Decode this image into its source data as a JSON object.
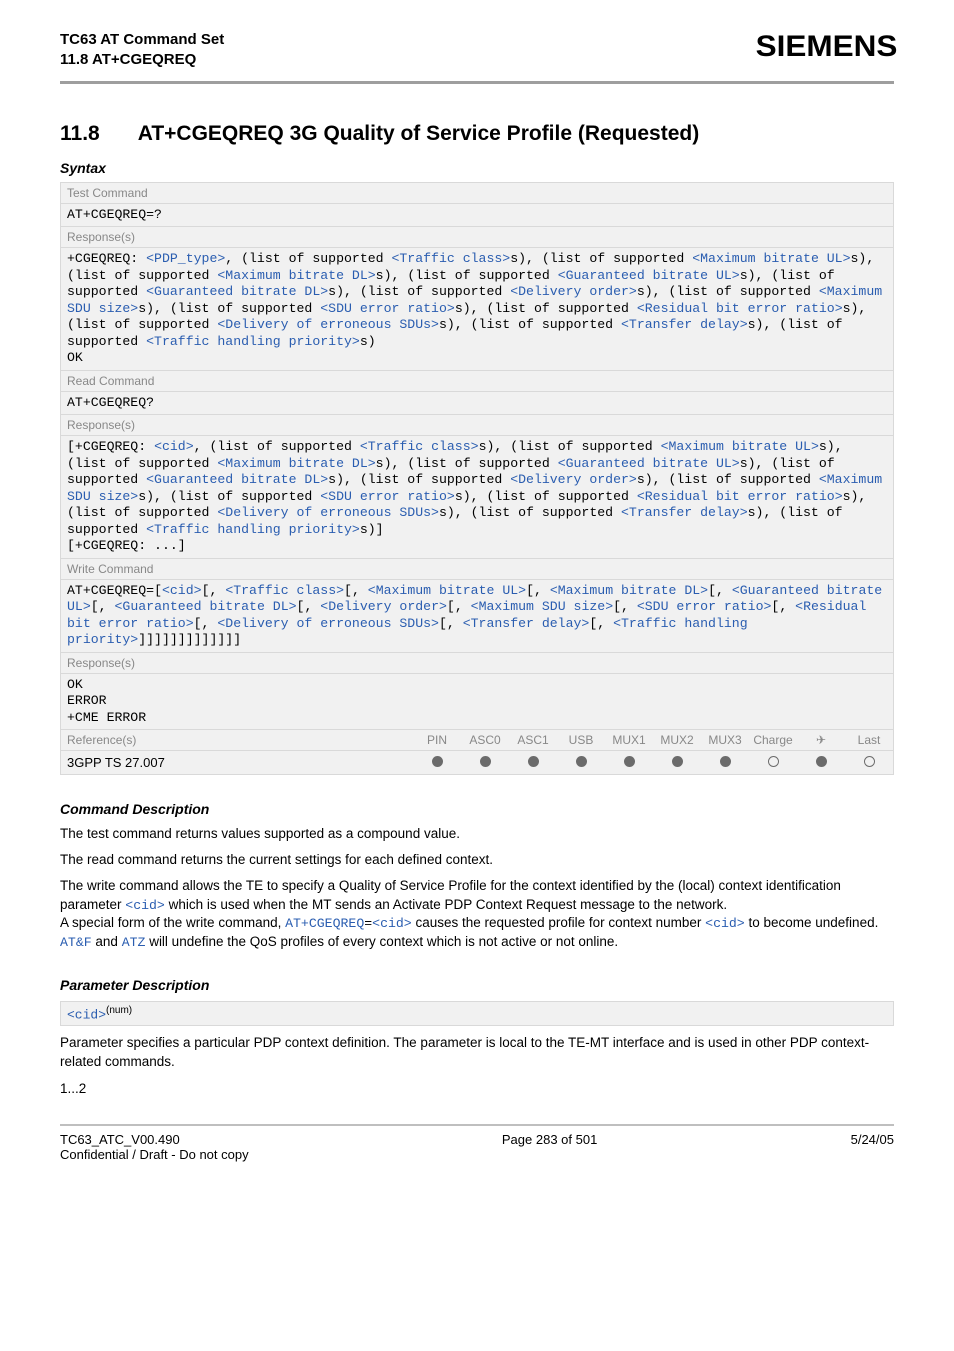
{
  "header": {
    "title_line1": "TC63 AT Command Set",
    "title_line2": "11.8 AT+CGEQREQ",
    "brand": "SIEMENS"
  },
  "section": {
    "number": "11.8",
    "title": "AT+CGEQREQ   3G Quality of Service Profile (Requested)"
  },
  "syntax_label": "Syntax",
  "labels": {
    "test_cmd": "Test Command",
    "read_cmd": "Read Command",
    "write_cmd": "Write Command",
    "responses": "Response(s)",
    "references": "Reference(s)"
  },
  "test": {
    "cmd": "AT+CGEQREQ=?",
    "resp_prefix": "+CGEQREQ: ",
    "params": {
      "pdp_type": "<PDP_type>",
      "traffic_class": "<Traffic class>",
      "max_br_ul": "<Maximum bitrate UL>",
      "max_br_dl": "<Maximum bitrate DL>",
      "gtd_br_ul": "<Guaranteed bitrate UL>",
      "gtd_br_dl": "<Guaranteed bitrate DL>",
      "del_order": "<Delivery order>",
      "max_sdu": "<Maximum SDU size>",
      "sdu_err": "<SDU error ratio>",
      "res_bit_err": "<Residual bit error ratio>",
      "del_err_sdu": "<Delivery of erroneous SDUs>",
      "transfer_delay": "<Transfer delay>",
      "traffic_prio": "<Traffic handling priority>"
    },
    "ok": "OK"
  },
  "read": {
    "cmd": "AT+CGEQREQ?",
    "resp_open": "[+CGEQREQ: ",
    "cid": "<cid>",
    "resp_trail": "[+CGEQREQ: ...]"
  },
  "write": {
    "cmd_prefix": "AT+CGEQREQ=",
    "resp_ok": "OK",
    "resp_err": "ERROR",
    "resp_cme": "+CME ERROR"
  },
  "ref_table": {
    "cols": [
      "PIN",
      "ASC0",
      "ASC1",
      "USB",
      "MUX1",
      "MUX2",
      "MUX3",
      "Charge",
      "✈",
      "Last"
    ],
    "ref_value": "3GPP TS 27.007",
    "dots": [
      "f",
      "f",
      "f",
      "f",
      "f",
      "f",
      "f",
      "o",
      "f",
      "o"
    ]
  },
  "cmd_desc_h": "Command Description",
  "cmd_desc": {
    "p1": "The test command returns values supported as a compound value.",
    "p2": "The read command returns the current settings for each defined context.",
    "p3a": "The write command allows the TE to specify a Quality of Service Profile for the context identified by the (local) context identification parameter ",
    "p3_cid": "<cid>",
    "p3b": " which is used when the MT sends an Activate PDP Context Request message to the network.",
    "p4a": "A special form of the write command, ",
    "p4_cmd": "AT+CGEQREQ",
    "p4_eq": "=",
    "p4_cid": "<cid>",
    "p4b": " causes the requested profile for context number ",
    "p4_cid2": "<cid>",
    "p4c": " to become undefined.",
    "p5a": "AT&F",
    "p5b": " and ",
    "p5c": "ATZ",
    "p5d": " will undefine the QoS profiles of every context which is not active or not online."
  },
  "param_desc_h": "Parameter Description",
  "param_cid": {
    "name": "<cid>",
    "sup": "(num)",
    "text": "Parameter specifies a particular PDP context definition. The parameter is local to the TE-MT interface and is used in other PDP context-related commands.",
    "range": "1...2"
  },
  "footer": {
    "left1": "TC63_ATC_V00.490",
    "left2": "Confidential / Draft - Do not copy",
    "center": "Page 283 of 501",
    "right": "5/24/05"
  },
  "glue": {
    "comma_list_sup": ", (list of supported ",
    "s_close": "s)",
    "s_close_comma": "s), ",
    "open_br": "[",
    "close_br": "]",
    "comma": ", ",
    "comma_nosp": ",",
    "close_brackets_many": "]]]]]]]]]]]]]"
  }
}
